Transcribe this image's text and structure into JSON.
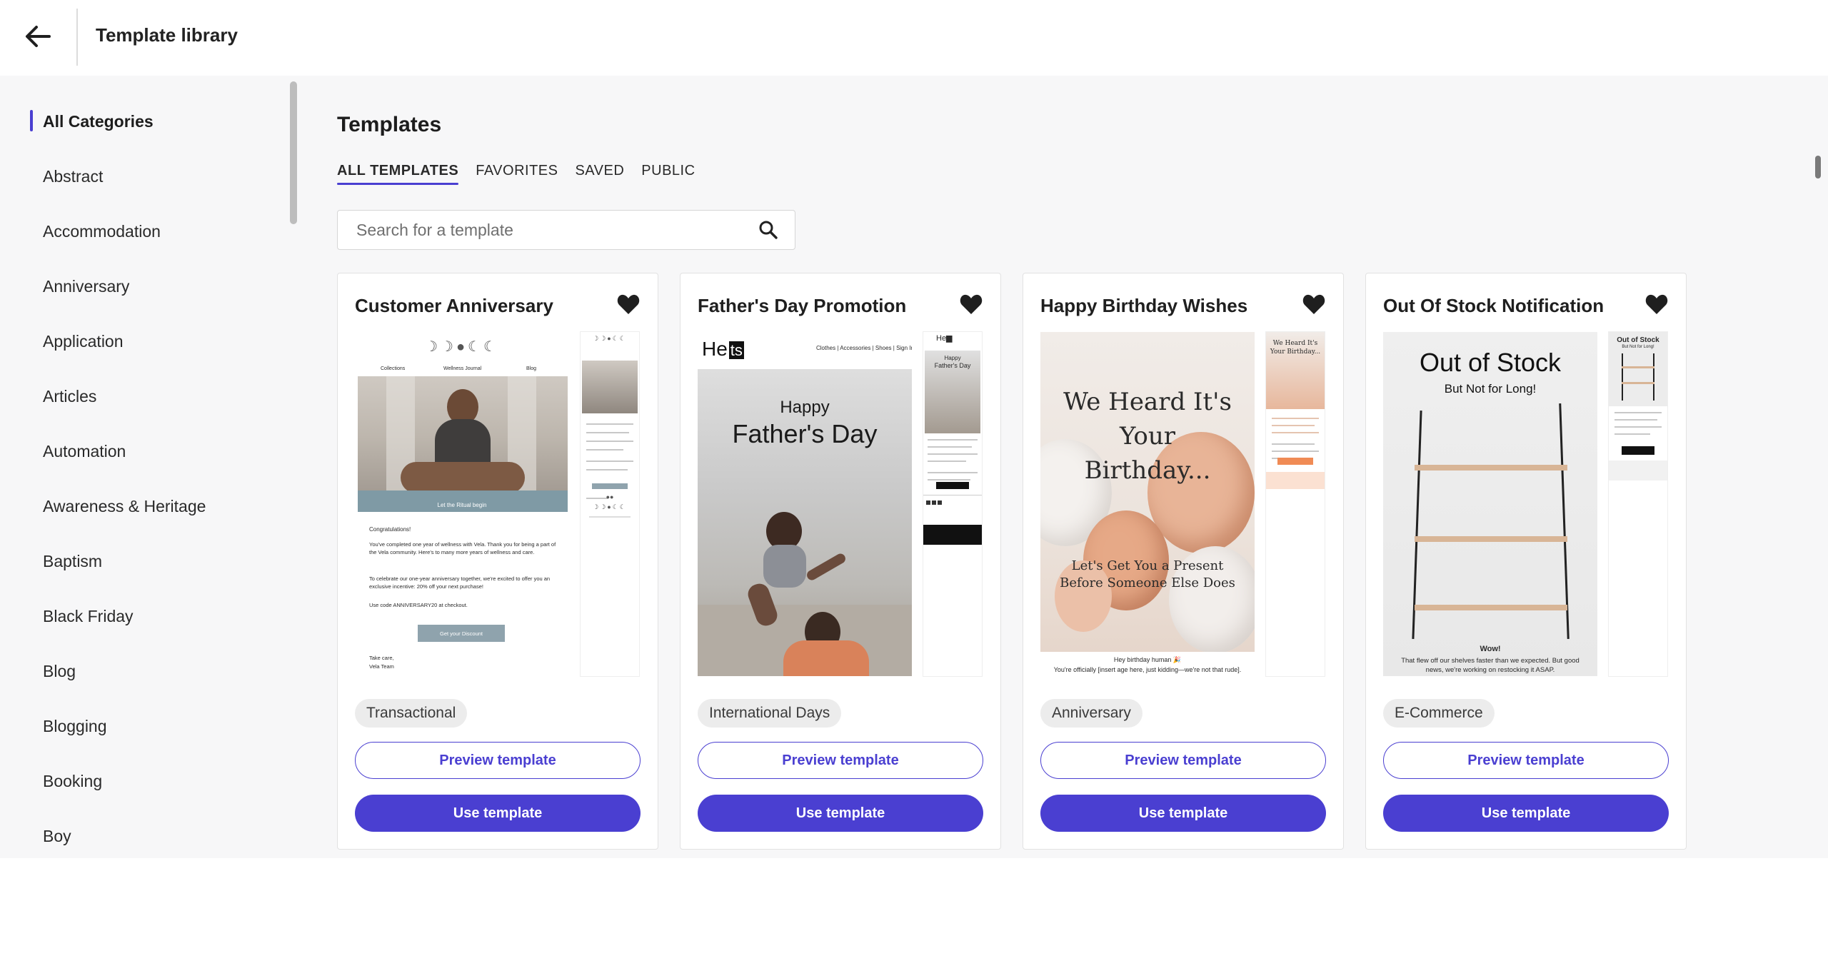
{
  "header": {
    "title": "Template library"
  },
  "sidebar": {
    "items": [
      {
        "label": "All Categories"
      },
      {
        "label": "Abstract"
      },
      {
        "label": "Accommodation"
      },
      {
        "label": "Anniversary"
      },
      {
        "label": "Application"
      },
      {
        "label": "Articles"
      },
      {
        "label": "Automation"
      },
      {
        "label": "Awareness & Heritage"
      },
      {
        "label": "Baptism"
      },
      {
        "label": "Black Friday"
      },
      {
        "label": "Blog"
      },
      {
        "label": "Blogging"
      },
      {
        "label": "Booking"
      },
      {
        "label": "Boy"
      }
    ],
    "active_index": 0
  },
  "main": {
    "title": "Templates",
    "tabs": [
      {
        "label": "ALL TEMPLATES"
      },
      {
        "label": "FAVORITES"
      },
      {
        "label": "SAVED"
      },
      {
        "label": "PUBLIC"
      }
    ],
    "active_tab": 0,
    "search": {
      "placeholder": "Search for a template",
      "value": ""
    }
  },
  "cards": [
    {
      "title": "Customer Anniversary",
      "tag": "Transactional",
      "preview_label": "Preview template",
      "use_label": "Use template",
      "thumb": {
        "nav": [
          "Collections",
          "Wellness Journal",
          "Blog"
        ],
        "hero_caption": "Let the Ritual begin",
        "greeting": "Congratulations!",
        "body1": "You've completed one year of wellness with Vela. Thank you for being a part of the Vela community. Here's to many more years of wellness and care.",
        "body2": "To celebrate our one-year anniversary together, we're excited to offer you an exclusive incentive: 20% off your next purchase!",
        "body3": "Use code ANNIVERSARY20 at checkout.",
        "cta": "Get your Discount",
        "signoff1": "Take care,",
        "signoff2": "Vela Team"
      }
    },
    {
      "title": "Father's Day Promotion",
      "tag": "International Days",
      "preview_label": "Preview template",
      "use_label": "Use template",
      "thumb": {
        "logo": "He",
        "logo_box": "ts",
        "nav": "Clothes | Accessories | Shoes | Sign In",
        "headline_small": "Happy",
        "headline_big": "Father's Day",
        "side_small": "Happy",
        "side_big": "Father's Day"
      }
    },
    {
      "title": "Happy Birthday Wishes",
      "tag": "Anniversary",
      "preview_label": "Preview template",
      "use_label": "Use template",
      "thumb": {
        "headline": "We Heard It's Your Birthday...",
        "subline": "Let's Get You a Present Before Someone Else Does",
        "greeting": "Hey birthday human 🎉",
        "footer": "You're officially [insert age here, just kidding—we're not that rude].",
        "side_headline": "We Heard It's Your Birthday..."
      }
    },
    {
      "title": "Out Of Stock Notification",
      "tag": "E-Commerce",
      "preview_label": "Preview template",
      "use_label": "Use template",
      "thumb": {
        "headline": "Out of Stock",
        "subline": "But Not for Long!",
        "wow": "Wow!",
        "body": "That flew off our shelves faster than we expected. But good news, we're working on restocking it ASAP.",
        "side_headline": "Out of Stock",
        "side_subline": "But Not for Long!"
      }
    }
  ],
  "colors": {
    "accent": "#4a3fd1",
    "tag_bg": "#ececec",
    "content_bg": "#f7f7f8"
  },
  "icons": {
    "back": "arrow-left-icon",
    "search": "search-icon",
    "favorite": "heart-icon"
  }
}
